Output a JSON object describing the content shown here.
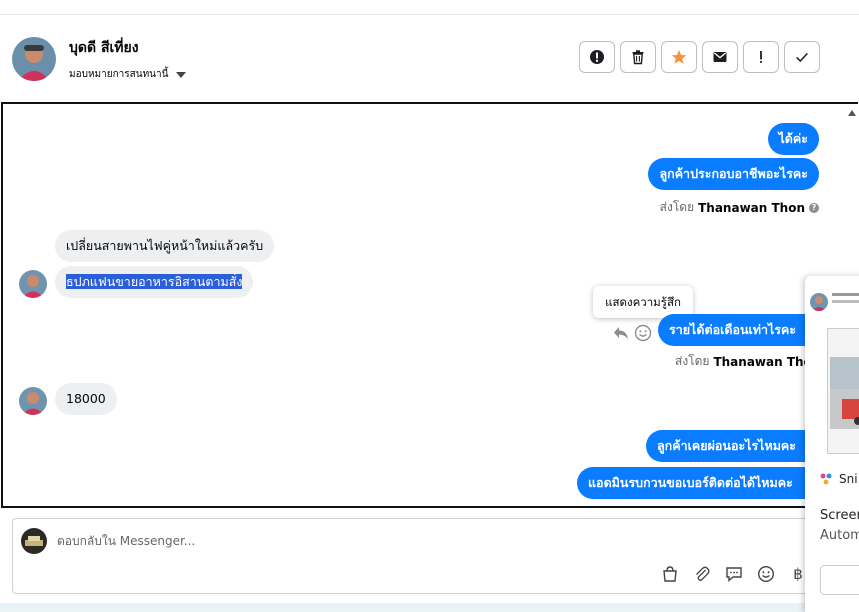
{
  "header": {
    "contact_name": "บุดดี สีเที่ยง",
    "assign_label": "มอบหมายการสนทนานี้",
    "toolbar": [
      "spam-alert-icon",
      "trash-icon",
      "star-icon",
      "envelope-icon",
      "exclamation-icon",
      "check-icon"
    ],
    "star_color": "#f7923b"
  },
  "messages": {
    "m1": "ได้ค่ะ",
    "m2": "ลูกค้าประกอบอาชีพอะไรคะ",
    "sent_by_1": {
      "prefix": "ส่งโดย",
      "agent": "Thanawan Thon"
    },
    "m3": "เปลี่ยนสายพานไฟคู่หน้าใหม่แล้วครับ",
    "m4": "ธปภแฟนขายอาหารอิสานตามสั่ง",
    "tooltip": "แสดงความรู้สึก",
    "m5": "รายได้ต่อเดือนเท่าไรคะ",
    "sent_by_2": {
      "prefix": "ส่งโดย",
      "agent": "Thanawan Thon"
    },
    "m6": "18000",
    "m7": "ลูกค้าเคยผ่อนอะไรไหมคะ",
    "m8": "แอดมินรบกวนขอเบอร์ติดต่อได้ไหมคะ"
  },
  "composer": {
    "placeholder": "ตอบกลับใน Messenger..."
  },
  "side_panel": {
    "app_name": "Sni",
    "line1": "Screen",
    "line2": "Autom"
  },
  "colors": {
    "outgoing_bubble": "#0a7cff",
    "incoming_bubble": "#eeeff1",
    "selected_text": "#2b5fd9"
  }
}
